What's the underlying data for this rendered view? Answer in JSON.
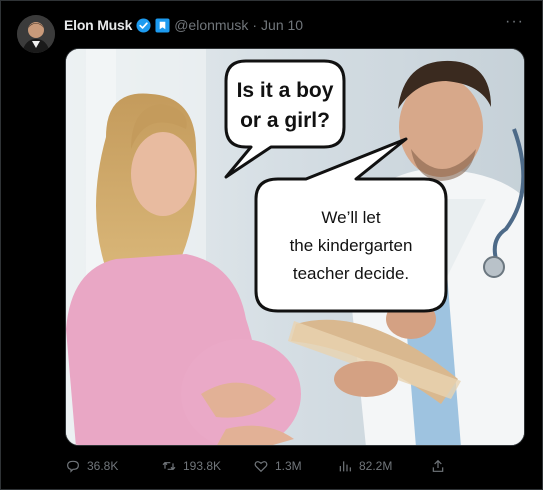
{
  "tweet": {
    "author_name": "Elon Musk",
    "author_handle": "@elonmusk",
    "separator": "·",
    "date": "Jun 10",
    "more_label": "···"
  },
  "media": {
    "bubble_left_line1": "Is it a boy",
    "bubble_left_line2": "or a girl?",
    "bubble_right_line1": "We’ll let",
    "bubble_right_line2": "the kindergarten",
    "bubble_right_line3": "teacher decide."
  },
  "stats": {
    "replies": "36.8K",
    "retweets": "193.8K",
    "likes": "1.3M",
    "views": "82.2M"
  },
  "colors": {
    "verified": "#1d9bf0",
    "text_secondary": "#71767b",
    "border": "#2f3336"
  },
  "icons": [
    "reply-icon",
    "retweet-icon",
    "like-icon",
    "views-icon",
    "share-icon",
    "verified-badge-icon",
    "government-badge-icon"
  ]
}
